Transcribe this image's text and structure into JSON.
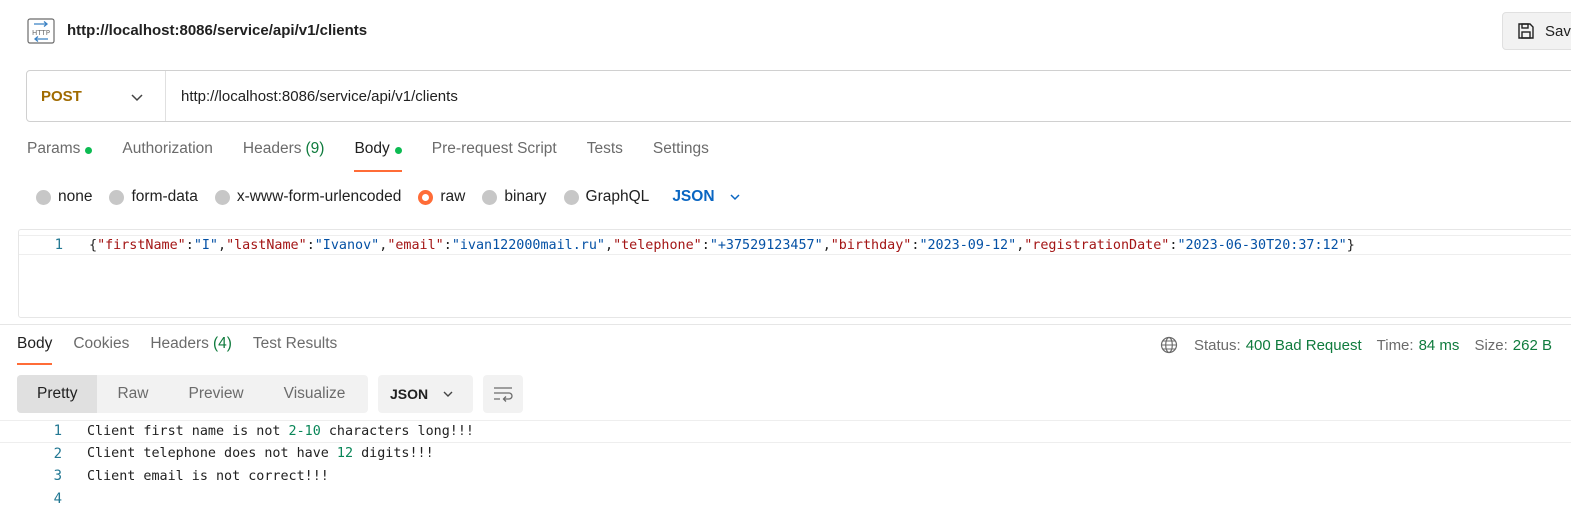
{
  "header": {
    "icon": "http-icon",
    "request_name": "http://localhost:8086/service/api/v1/clients",
    "save_label": "Sav"
  },
  "request": {
    "method": "POST",
    "url": "http://localhost:8086/service/api/v1/clients"
  },
  "request_tabs": [
    {
      "label": "Params",
      "dot": true
    },
    {
      "label": "Authorization"
    },
    {
      "label": "Headers",
      "count": "(9)"
    },
    {
      "label": "Body",
      "dot": true,
      "active": true
    },
    {
      "label": "Pre-request Script"
    },
    {
      "label": "Tests"
    },
    {
      "label": "Settings"
    }
  ],
  "body_modes": {
    "options": [
      "none",
      "form-data",
      "x-www-form-urlencoded",
      "raw",
      "binary",
      "GraphQL"
    ],
    "selected": "raw",
    "format": "JSON"
  },
  "editor": {
    "line_number": "1",
    "tokens": [
      {
        "t": "p",
        "s": "{"
      },
      {
        "t": "k",
        "s": "\"firstName\""
      },
      {
        "t": "p",
        "s": ":"
      },
      {
        "t": "v",
        "s": "\"I\""
      },
      {
        "t": "p",
        "s": ","
      },
      {
        "t": "k",
        "s": "\"lastName\""
      },
      {
        "t": "p",
        "s": ":"
      },
      {
        "t": "v",
        "s": "\"Ivanov\""
      },
      {
        "t": "p",
        "s": ","
      },
      {
        "t": "k",
        "s": "\"email\""
      },
      {
        "t": "p",
        "s": ":"
      },
      {
        "t": "v",
        "s": "\"ivan122000mail.ru\""
      },
      {
        "t": "p",
        "s": ","
      },
      {
        "t": "k",
        "s": "\"telephone\""
      },
      {
        "t": "p",
        "s": ":"
      },
      {
        "t": "v",
        "s": "\"+37529123457\""
      },
      {
        "t": "p",
        "s": ","
      },
      {
        "t": "k",
        "s": "\"birthday\""
      },
      {
        "t": "p",
        "s": ":"
      },
      {
        "t": "v",
        "s": "\"2023-09-12\""
      },
      {
        "t": "p",
        "s": ","
      },
      {
        "t": "k",
        "s": "\"registrationDate\""
      },
      {
        "t": "p",
        "s": ":"
      },
      {
        "t": "v",
        "s": "\"2023-06-30T20:37:12\""
      },
      {
        "t": "p",
        "s": "}"
      }
    ]
  },
  "response_tabs": [
    {
      "label": "Body",
      "active": true
    },
    {
      "label": "Cookies"
    },
    {
      "label": "Headers",
      "count": "(4)"
    },
    {
      "label": "Test Results"
    }
  ],
  "status": {
    "status_label": "Status:",
    "status_value": "400 Bad Request",
    "time_label": "Time:",
    "time_value": "84 ms",
    "size_label": "Size:",
    "size_value": "262 B"
  },
  "view_tabs": [
    "Pretty",
    "Raw",
    "Preview",
    "Visualize"
  ],
  "view_selected": "Pretty",
  "response_format": "JSON",
  "response_lines": [
    {
      "n": "1",
      "parts": [
        {
          "t": "p",
          "s": "Client first name is not "
        },
        {
          "t": "num",
          "s": "2-10"
        },
        {
          "t": "p",
          "s": " characters long!!!"
        }
      ]
    },
    {
      "n": "2",
      "parts": [
        {
          "t": "p",
          "s": "Client telephone does not have "
        },
        {
          "t": "num",
          "s": "12"
        },
        {
          "t": "p",
          "s": " digits!!!"
        }
      ]
    },
    {
      "n": "3",
      "parts": [
        {
          "t": "p",
          "s": "Client email is not correct!!!"
        }
      ]
    },
    {
      "n": "4",
      "parts": []
    }
  ],
  "colors": {
    "accent": "#ff6c37",
    "method": "#a06b00",
    "success": "#0f7b3d",
    "link": "#0a66c2"
  }
}
